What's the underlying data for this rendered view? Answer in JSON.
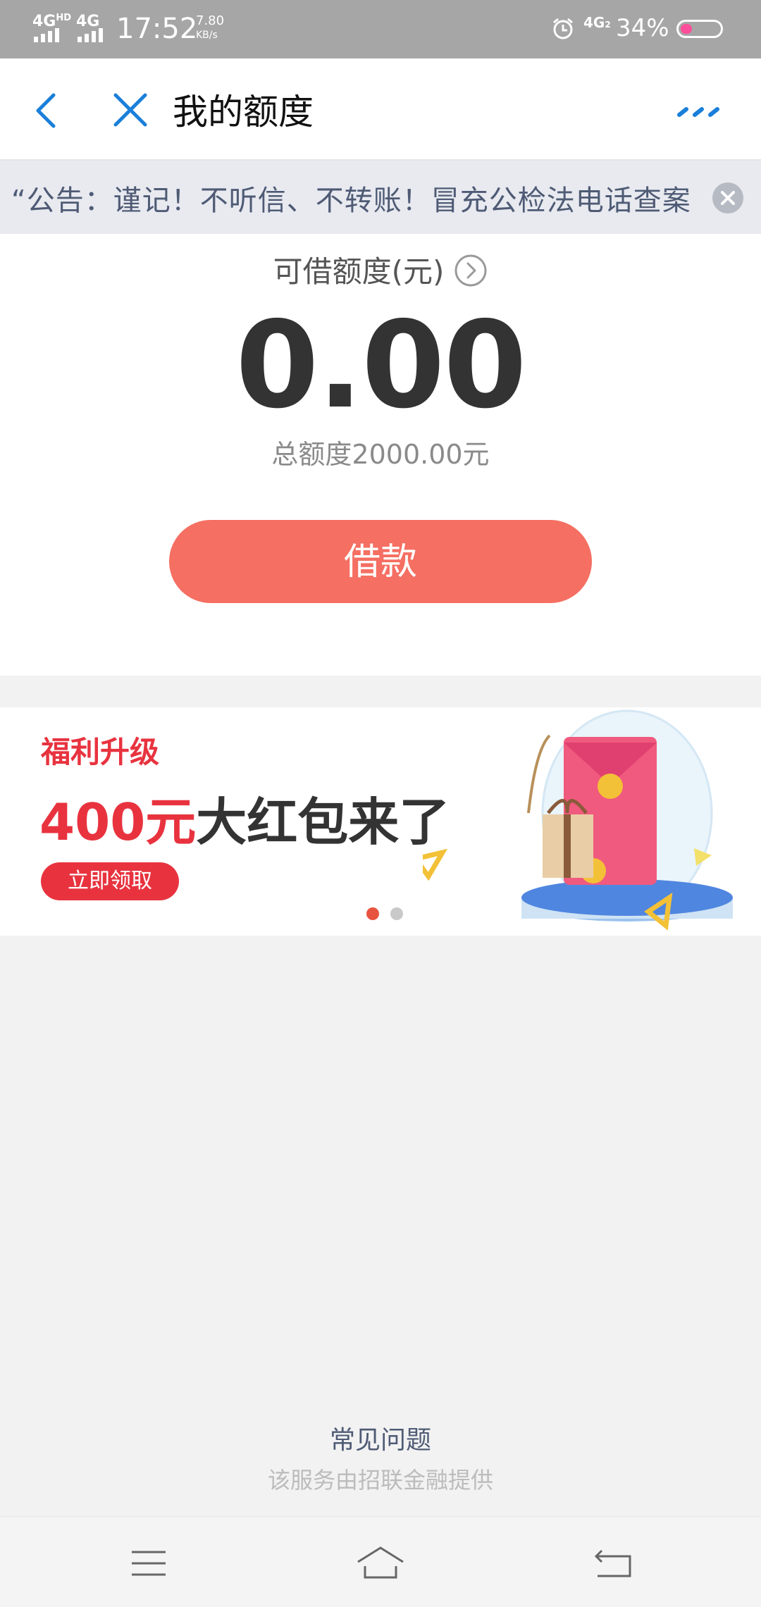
{
  "status_bar": {
    "network1": "4G",
    "network1_sup": "HD",
    "network2": "4G",
    "time": "17:52",
    "speed_value": "7.80",
    "speed_unit": "KB/s",
    "network3": "4G",
    "network3_sub": "2",
    "battery": "34%"
  },
  "nav": {
    "title": "我的额度",
    "back_icon": "chevron-left-icon",
    "close_icon": "close-icon",
    "more_icon": "more-dots-icon"
  },
  "notice": {
    "text": "“公告：谨记！不听信、不转账！冒充公检法电话查案"
  },
  "credit": {
    "label": "可借额度(元)",
    "amount": "0.00",
    "total": "总额度2000.00元",
    "borrow_button": "借款"
  },
  "banner": {
    "subtitle": "福利升级",
    "headline_red": "400元",
    "headline_dark": "大红包来了",
    "button": "立即领取",
    "page_count": 2,
    "active_page": 1
  },
  "footer": {
    "faq": "常见问题",
    "provider": "该服务由招联金融提供"
  },
  "colors": {
    "accent_blue": "#1a7fd9",
    "button_red": "#f56f62",
    "banner_red": "#e8333f"
  }
}
